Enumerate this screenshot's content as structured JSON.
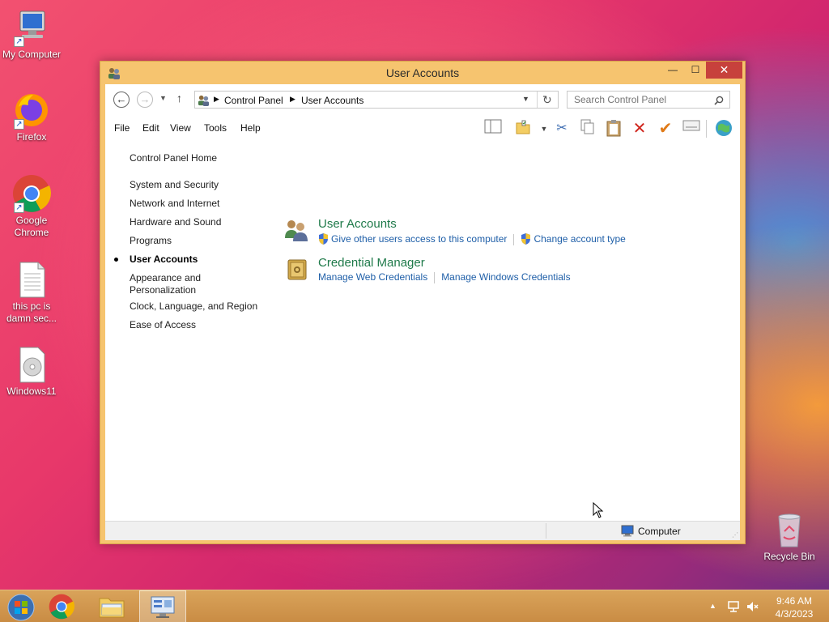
{
  "desktop": {
    "icons": [
      {
        "label": "My Computer",
        "icon": "computer-icon"
      },
      {
        "label": "Firefox",
        "icon": "firefox-icon"
      },
      {
        "label": "Google Chrome",
        "icon": "chrome-icon"
      },
      {
        "label": "this pc is damn sec...",
        "icon": "text-file-icon"
      },
      {
        "label": "Windows11",
        "icon": "disc-image-icon"
      },
      {
        "label": "Recycle Bin",
        "icon": "recycle-bin-icon"
      }
    ]
  },
  "window": {
    "title": "User Accounts",
    "address": {
      "crumbs": [
        "Control Panel",
        "User Accounts"
      ]
    },
    "search_placeholder": "Search Control Panel",
    "menu": [
      "File",
      "Edit",
      "View",
      "Tools",
      "Help"
    ],
    "left_pane": {
      "home": "Control Panel Home",
      "items": [
        "System and Security",
        "Network and Internet",
        "Hardware and Sound",
        "Programs",
        "User Accounts",
        "Appearance and Personalization",
        "Clock, Language, and Region",
        "Ease of Access"
      ],
      "active": "User Accounts"
    },
    "categories": [
      {
        "title": "User Accounts",
        "links": [
          "Give other users access to this computer",
          "Change account type"
        ]
      },
      {
        "title": "Credential Manager",
        "links": [
          "Manage Web Credentials",
          "Manage Windows Credentials"
        ]
      }
    ],
    "status": "Computer"
  },
  "taskbar": {
    "time": "9:46 AM",
    "date": "4/3/2023"
  }
}
